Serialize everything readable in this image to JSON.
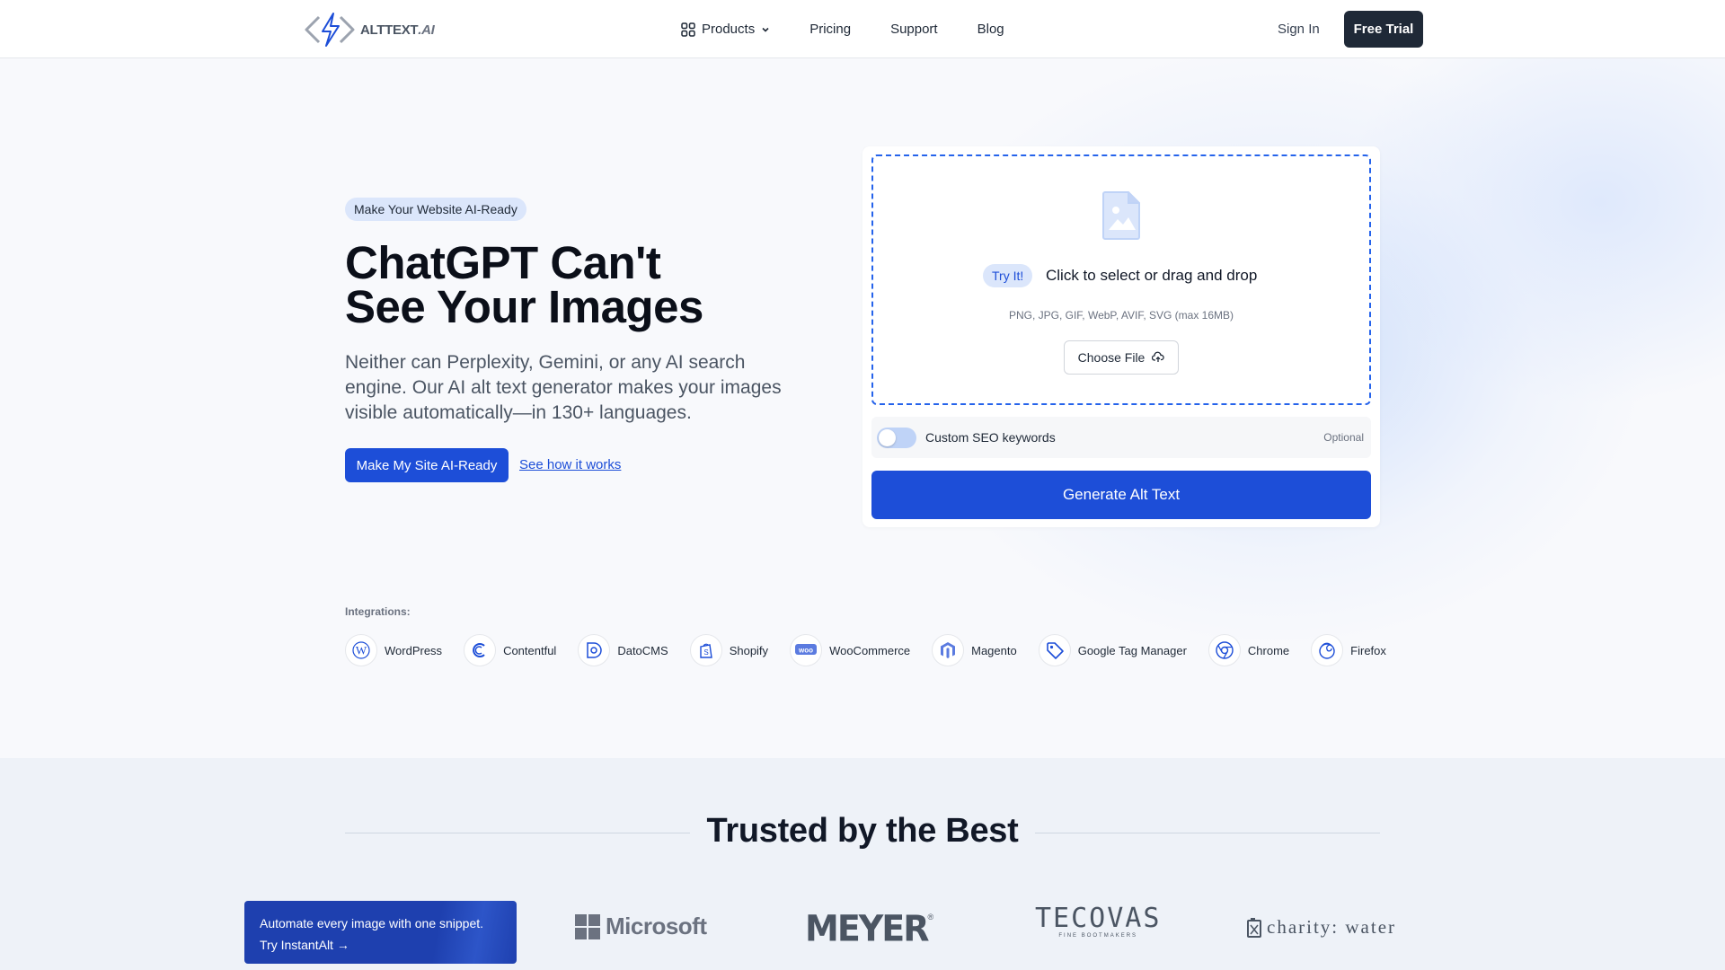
{
  "header": {
    "logo_text": "ALTTEXT",
    "logo_suffix": ".AI",
    "nav": {
      "products": "Products",
      "pricing": "Pricing",
      "support": "Support",
      "blog": "Blog"
    },
    "sign_in": "Sign In",
    "free_trial": "Free Trial"
  },
  "hero": {
    "badge": "Make Your Website AI-Ready",
    "title_line1": "ChatGPT Can't",
    "title_line2": "See Your Images",
    "subtitle": "Neither can Perplexity, Gemini, or any AI search engine. Our AI alt text generator makes your images visible automatically—in 130+ languages.",
    "cta_primary": "Make My Site AI-Ready",
    "cta_link": "See how it works"
  },
  "upload": {
    "try_badge": "Try It!",
    "drop_text": "Click to select or drag and drop",
    "formats": "PNG, JPG, GIF, WebP, AVIF, SVG (max 16MB)",
    "choose_file": "Choose File",
    "seo_label": "Custom SEO keywords",
    "seo_optional": "Optional",
    "seo_enabled": false,
    "generate": "Generate Alt Text"
  },
  "integrations": {
    "label": "Integrations:",
    "items": [
      {
        "name": "WordPress",
        "icon": "wordpress-icon"
      },
      {
        "name": "Contentful",
        "icon": "contentful-icon"
      },
      {
        "name": "DatoCMS",
        "icon": "datocms-icon"
      },
      {
        "name": "Shopify",
        "icon": "shopify-icon"
      },
      {
        "name": "WooCommerce",
        "icon": "woocommerce-icon"
      },
      {
        "name": "Magento",
        "icon": "magento-icon"
      },
      {
        "name": "Google Tag Manager",
        "icon": "google-tag-manager-icon"
      },
      {
        "name": "Chrome",
        "icon": "chrome-icon"
      },
      {
        "name": "Firefox",
        "icon": "firefox-icon"
      }
    ]
  },
  "trusted": {
    "title": "Trusted by the Best",
    "promo_line1": "Automate every image with one snippet.",
    "promo_line2": "Try InstantAlt →",
    "brands": [
      "Microsoft",
      "MEYER",
      "TECOVAS",
      "FINE BOOTMAKERS",
      "charity: water"
    ]
  },
  "colors": {
    "accent": "#1d4ed8",
    "dark_button": "#1f2937",
    "badge_bg": "#dbe6fb",
    "section_bg": "#eef2f8"
  }
}
